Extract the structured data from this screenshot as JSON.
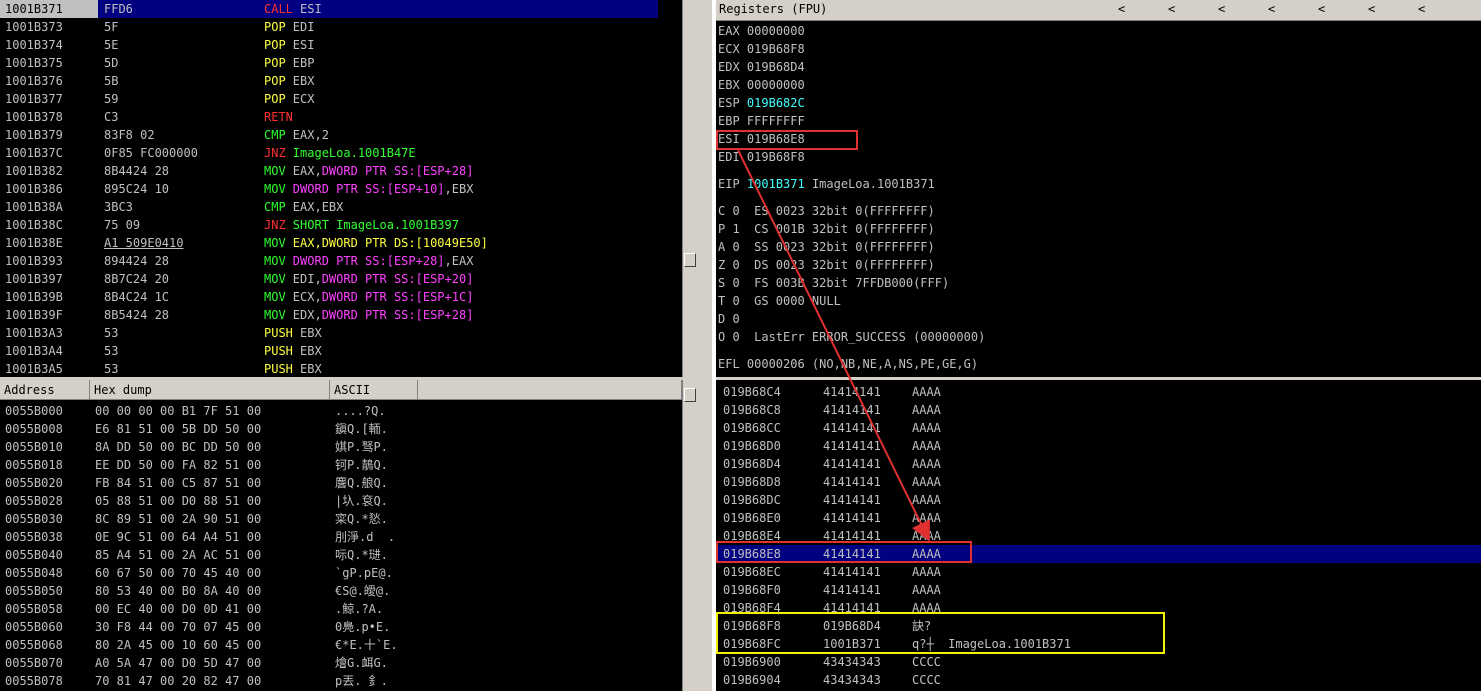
{
  "disasm": {
    "rows": [
      {
        "addr": "1001B371",
        "hex": "FFD6",
        "mn": "CALL",
        "op": "ESI",
        "mnc": "red",
        "opc": "grey",
        "selected": true
      },
      {
        "addr": "1001B373",
        "hex": "5F",
        "mn": "POP",
        "op": "EDI",
        "mnc": "yellow",
        "opc": "grey"
      },
      {
        "addr": "1001B374",
        "hex": "5E",
        "mn": "POP",
        "op": "ESI",
        "mnc": "yellow",
        "opc": "grey"
      },
      {
        "addr": "1001B375",
        "hex": "5D",
        "mn": "POP",
        "op": "EBP",
        "mnc": "yellow",
        "opc": "grey"
      },
      {
        "addr": "1001B376",
        "hex": "5B",
        "mn": "POP",
        "op": "EBX",
        "mnc": "yellow",
        "opc": "grey"
      },
      {
        "addr": "1001B377",
        "hex": "59",
        "mn": "POP",
        "op": "ECX",
        "mnc": "yellow",
        "opc": "grey"
      },
      {
        "addr": "1001B378",
        "hex": "C3",
        "mn": "RETN",
        "op": "",
        "mnc": "red",
        "opc": "grey"
      },
      {
        "addr": "1001B379",
        "hex": "83F8 02",
        "mn": "CMP",
        "op": "EAX,2",
        "mnc": "green",
        "opc": "grey"
      },
      {
        "addr": "1001B37C",
        "hex": "0F85 FC000000",
        "mn": "JNZ",
        "op": "ImageLoa.1001B47E",
        "mnc": "red",
        "opc": "green"
      },
      {
        "addr": "1001B382",
        "hex": "8B4424 28",
        "mn": "MOV",
        "op": "EAX,",
        "op2": "DWORD PTR SS:[ESP+28]",
        "mnc": "green",
        "opc": "grey",
        "op2c": "magenta"
      },
      {
        "addr": "1001B386",
        "hex": "895C24 10",
        "mn": "MOV",
        "op": "DWORD PTR SS:[ESP+10]",
        "op2": ",EBX",
        "mnc": "green",
        "opc": "magenta",
        "op2c": "grey"
      },
      {
        "addr": "1001B38A",
        "hex": "3BC3",
        "mn": "CMP",
        "op": "EAX,EBX",
        "mnc": "green",
        "opc": "grey"
      },
      {
        "addr": "1001B38C",
        "hex": "75 09",
        "mn": "JNZ",
        "op": "SHORT ImageLoa.1001B397",
        "mnc": "red",
        "opc": "green"
      },
      {
        "addr": "1001B38E",
        "hex": "A1 509E0410",
        "mn": "MOV",
        "op": "EAX,DWORD PTR DS:[10049E50]",
        "mnc": "green",
        "opc": "yellow",
        "ul": true
      },
      {
        "addr": "1001B393",
        "hex": "894424 28",
        "mn": "MOV",
        "op": "DWORD PTR SS:[ESP+28]",
        "op2": ",EAX",
        "mnc": "green",
        "opc": "magenta",
        "op2c": "grey"
      },
      {
        "addr": "1001B397",
        "hex": "8B7C24 20",
        "mn": "MOV",
        "op": "EDI,",
        "op2": "DWORD PTR SS:[ESP+20]",
        "mnc": "green",
        "opc": "grey",
        "op2c": "magenta"
      },
      {
        "addr": "1001B39B",
        "hex": "8B4C24 1C",
        "mn": "MOV",
        "op": "ECX,",
        "op2": "DWORD PTR SS:[ESP+1C]",
        "mnc": "green",
        "opc": "grey",
        "op2c": "magenta"
      },
      {
        "addr": "1001B39F",
        "hex": "8B5424 28",
        "mn": "MOV",
        "op": "EDX,",
        "op2": "DWORD PTR SS:[ESP+28]",
        "mnc": "green",
        "opc": "grey",
        "op2c": "magenta"
      },
      {
        "addr": "1001B3A3",
        "hex": "53",
        "mn": "PUSH",
        "op": "EBX",
        "mnc": "yellow",
        "opc": "grey"
      },
      {
        "addr": "1001B3A4",
        "hex": "53",
        "mn": "PUSH",
        "op": "EBX",
        "mnc": "yellow",
        "opc": "grey"
      },
      {
        "addr": "1001B3A5",
        "hex": "53",
        "mn": "PUSH",
        "op": "EBX",
        "mnc": "yellow",
        "opc": "grey"
      }
    ]
  },
  "registers": {
    "title": "Registers (FPU)",
    "arrows": [
      "<",
      "<",
      "<",
      "<",
      "<",
      "<",
      "<"
    ],
    "gp": [
      {
        "name": "EAX",
        "val": "00000000",
        "hl": false
      },
      {
        "name": "ECX",
        "val": "019B68F8",
        "hl": false
      },
      {
        "name": "EDX",
        "val": "019B68D4",
        "hl": false
      },
      {
        "name": "EBX",
        "val": "00000000",
        "hl": false
      },
      {
        "name": "ESP",
        "val": "019B682C",
        "hl": true
      },
      {
        "name": "EBP",
        "val": "FFFFFFFF",
        "hl": false
      },
      {
        "name": "ESI",
        "val": "019B68E8",
        "hl": false
      },
      {
        "name": "EDI",
        "val": "019B68F8",
        "hl": false
      }
    ],
    "eip": {
      "name": "EIP",
      "val": "1001B371",
      "desc": "ImageLoa.1001B371"
    },
    "flags": [
      "C 0  ES 0023 32bit 0(FFFFFFFF)",
      "P 1  CS 001B 32bit 0(FFFFFFFF)",
      "A 0  SS 0023 32bit 0(FFFFFFFF)",
      "Z 0  DS 0023 32bit 0(FFFFFFFF)",
      "S 0  FS 003B 32bit 7FFDB000(FFF)",
      "T 0  GS 0000 NULL",
      "D 0",
      "O 0  LastErr ERROR_SUCCESS (00000000)"
    ],
    "efl": "EFL 00000206 (NO,NB,NE,A,NS,PE,GE,G)"
  },
  "dump": {
    "headers": [
      "Address",
      "Hex dump",
      "ASCII"
    ],
    "rows": [
      {
        "addr": "0055B000",
        "hex": "00 00 00 00 B1 7F 51 00",
        "ascii": "....?Q."
      },
      {
        "addr": "0055B008",
        "hex": "E6 81 51 00 5B DD 50 00",
        "ascii": "鎭Q.[輀."
      },
      {
        "addr": "0055B010",
        "hex": "8A DD 50 00 BC DD 50 00",
        "ascii": "娸P.驽P."
      },
      {
        "addr": "0055B018",
        "hex": "EE DD 50 00 FA 82 51 00",
        "ascii": "钶P.鶄Q."
      },
      {
        "addr": "0055B020",
        "hex": "FB 84 51 00 C5 87 51 00",
        "ascii": "麐Q.艆Q."
      },
      {
        "addr": "0055B028",
        "hex": "05 88 51 00 D0 88 51 00",
        "ascii": "|圦.袞Q."
      },
      {
        "addr": "0055B030",
        "hex": "8C 89 51 00 2A 90 51 00",
        "ascii": "寀Q.*悐."
      },
      {
        "addr": "0055B038",
        "hex": "0E 9C 51 00 64 A4 51 00",
        "ascii": "刖淨.d  ."
      },
      {
        "addr": "0055B040",
        "hex": "85 A4 51 00 2A AC 51 00",
        "ascii": "呩Q.*琎."
      },
      {
        "addr": "0055B048",
        "hex": "60 67 50 00 70 45 40 00",
        "ascii": "`gP.pE@."
      },
      {
        "addr": "0055B050",
        "hex": "80 53 40 00 B0 8A 40 00",
        "ascii": "€S@.皧@."
      },
      {
        "addr": "0055B058",
        "hex": "00 EC 40 00 D0 0D 41 00",
        "ascii": ".鯨.?A."
      },
      {
        "addr": "0055B060",
        "hex": "30 F8 44 00 70 07 45 00",
        "ascii": "0鳧.p•E."
      },
      {
        "addr": "0055B068",
        "hex": "80 2A 45 00 10 60 45 00",
        "ascii": "€*E.十`E."
      },
      {
        "addr": "0055B070",
        "hex": "A0 5A 47 00 D0 5D 47 00",
        "ascii": "燴G.衈G."
      },
      {
        "addr": "0055B078",
        "hex": "70 81 47 00 20 82 47 00",
        "ascii": "p丟. 釒."
      }
    ]
  },
  "stack": {
    "rows": [
      {
        "addr": "019B68C4",
        "val": "41414141",
        "txt": "AAAA"
      },
      {
        "addr": "019B68C8",
        "val": "41414141",
        "txt": "AAAA"
      },
      {
        "addr": "019B68CC",
        "val": "41414141",
        "txt": "AAAA"
      },
      {
        "addr": "019B68D0",
        "val": "41414141",
        "txt": "AAAA"
      },
      {
        "addr": "019B68D4",
        "val": "41414141",
        "txt": "AAAA"
      },
      {
        "addr": "019B68D8",
        "val": "41414141",
        "txt": "AAAA"
      },
      {
        "addr": "019B68DC",
        "val": "41414141",
        "txt": "AAAA"
      },
      {
        "addr": "019B68E0",
        "val": "41414141",
        "txt": "AAAA"
      },
      {
        "addr": "019B68E4",
        "val": "41414141",
        "txt": "AAAA"
      },
      {
        "addr": "019B68E8",
        "val": "41414141",
        "txt": "AAAA",
        "selected": true
      },
      {
        "addr": "019B68EC",
        "val": "41414141",
        "txt": "AAAA"
      },
      {
        "addr": "019B68F0",
        "val": "41414141",
        "txt": "AAAA"
      },
      {
        "addr": "019B68F4",
        "val": "41414141",
        "txt": "AAAA"
      },
      {
        "addr": "019B68F8",
        "val": "019B68D4",
        "txt": "訣?"
      },
      {
        "addr": "019B68FC",
        "val": "1001B371",
        "txt": "q?┼  ImageLoa.1001B371"
      },
      {
        "addr": "019B6900",
        "val": "43434343",
        "txt": "CCCC"
      },
      {
        "addr": "019B6904",
        "val": "43434343",
        "txt": "CCCC"
      }
    ]
  },
  "colors": {
    "red_box": "#e03030",
    "yellow_box": "#f0f000",
    "selection": "#000080"
  }
}
